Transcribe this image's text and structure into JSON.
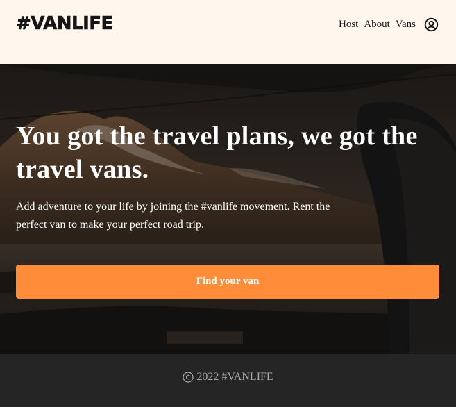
{
  "header": {
    "logo": "#VANLIFE",
    "nav": [
      {
        "label": "Host"
      },
      {
        "label": "About"
      },
      {
        "label": "Vans"
      }
    ],
    "profile_icon": "user-circle-icon"
  },
  "hero": {
    "title": "You got the travel plans, we got the travel vans.",
    "subtitle": "Add adventure to your life by joining the #vanlife movement. Rent the perfect van to make your perfect road trip.",
    "cta_label": "Find your van"
  },
  "footer": {
    "copyright_icon": "copyright-icon",
    "text": "2022 #VANLIFE"
  },
  "colors": {
    "header_bg": "#fff7ed",
    "cta": "#ff8c38",
    "footer_bg": "#252525",
    "footer_text": "#aaaaaa"
  }
}
